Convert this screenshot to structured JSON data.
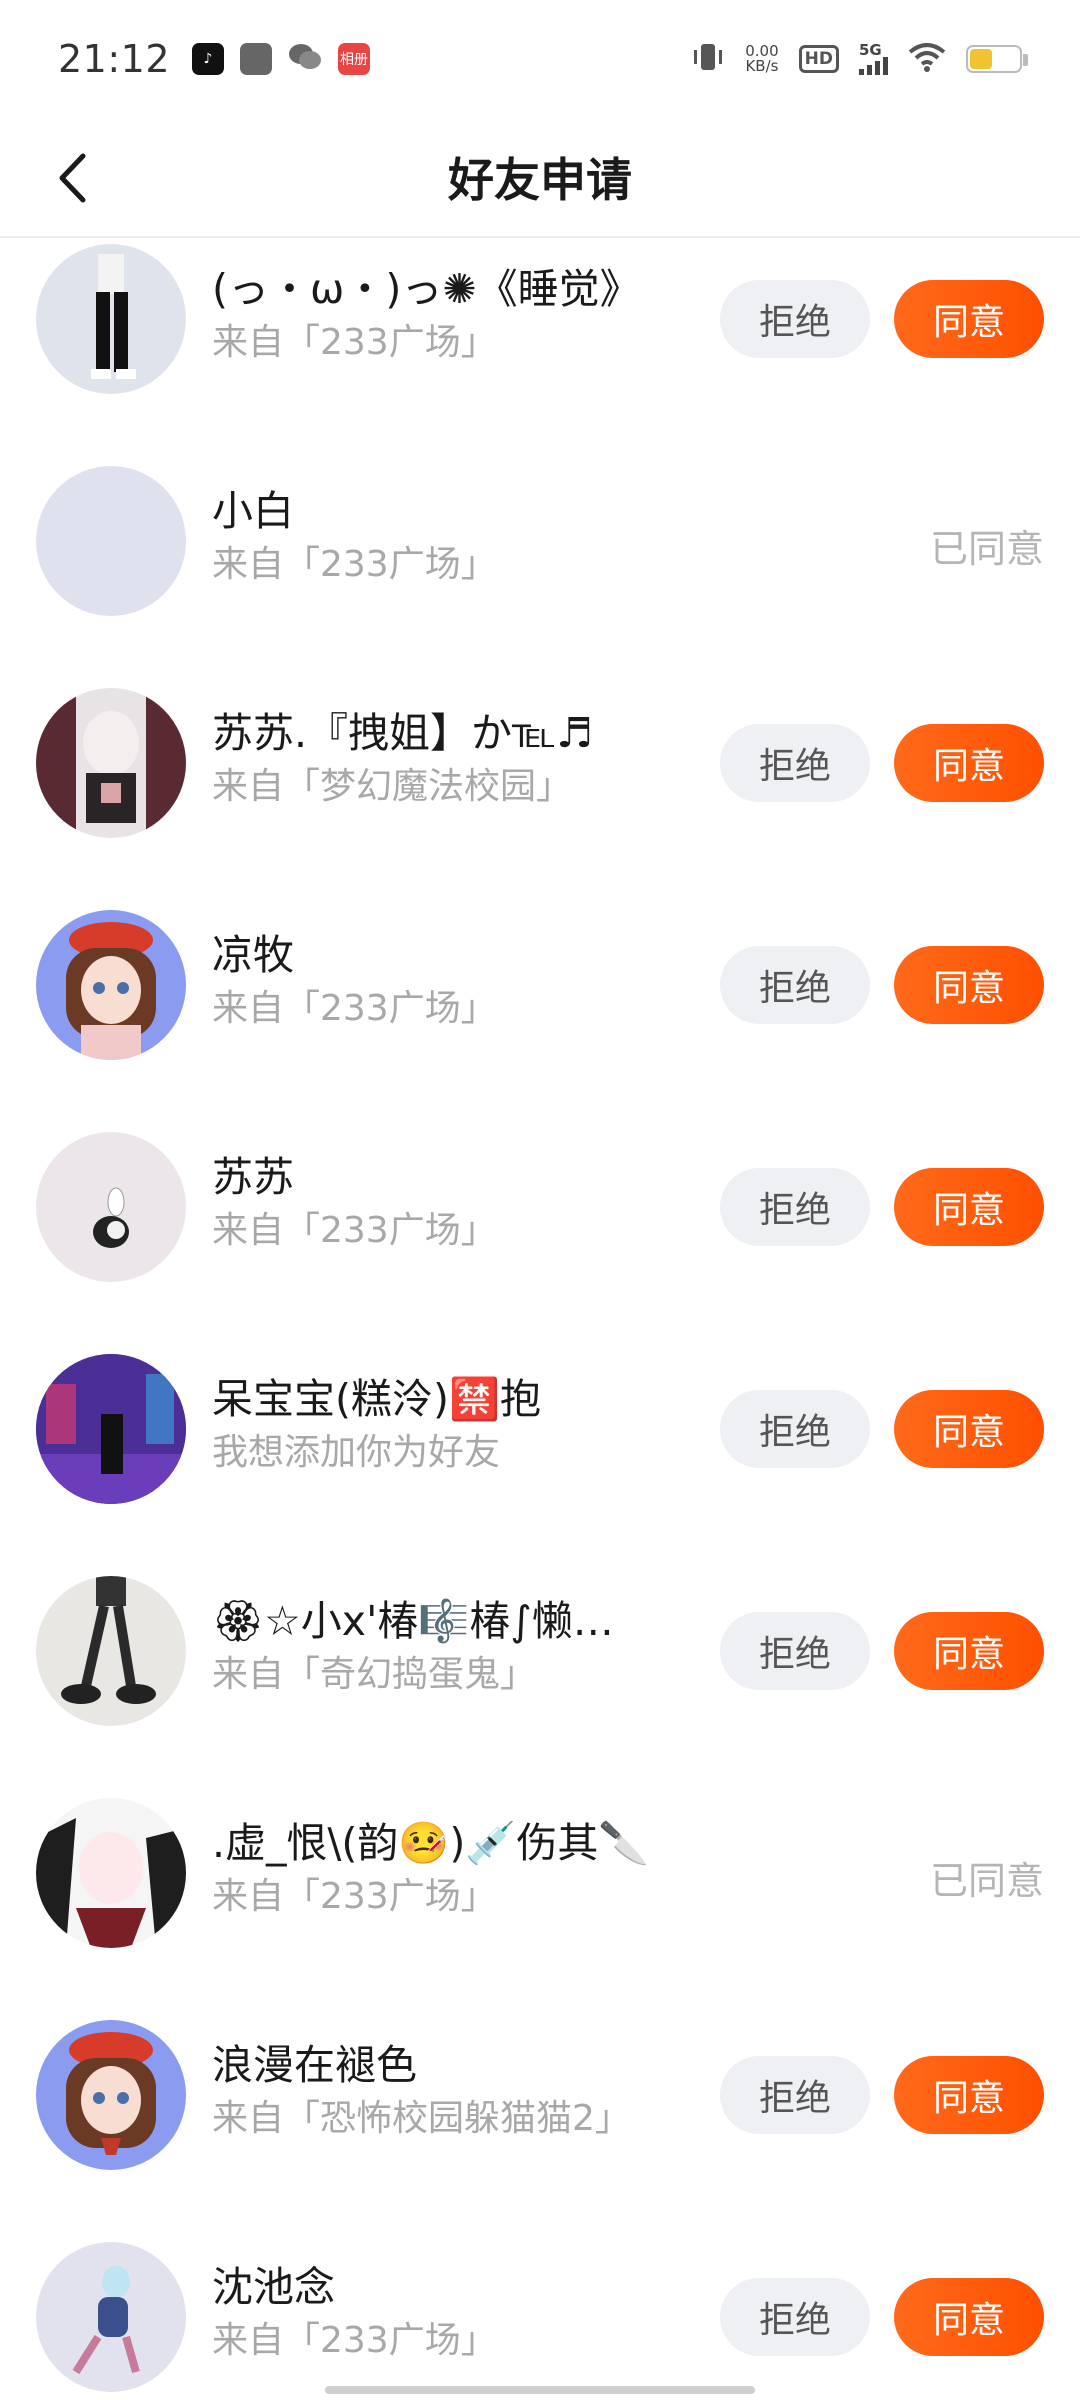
{
  "status_bar": {
    "time": "21:12",
    "net_speed_value": "0.00",
    "net_speed_unit": "KB/s",
    "hd": "HD",
    "network": "5G",
    "app_badge": "相册"
  },
  "header": {
    "title": "好友申请"
  },
  "buttons": {
    "reject": "拒绝",
    "accept": "同意",
    "accepted": "已同意"
  },
  "requests": [
    {
      "name": "(っ・ω・)っ✺《睡觉》",
      "source": "来自「233广场」",
      "status": "pending"
    },
    {
      "name": "小白",
      "source": "来自「233广场」",
      "status": "accepted"
    },
    {
      "name": "苏苏.『拽姐】か℡♬",
      "source": "来自「梦幻魔法校园」",
      "status": "pending"
    },
    {
      "name": "凉牧",
      "source": "来自「233广场」",
      "status": "pending"
    },
    {
      "name": "苏苏",
      "source": "来自「233广场」",
      "status": "pending"
    },
    {
      "name": "呆宝宝(糕泠)🈲抱",
      "source": "我想添加你为好友",
      "status": "pending"
    },
    {
      "name": "🏵☆小x'椿🎼椿∫懒…",
      "source": "来自「奇幻捣蛋鬼」",
      "status": "pending"
    },
    {
      "name": ".虚_恨\\(韵🤒)💉伤其🔪",
      "source": "来自「233广场」",
      "status": "accepted"
    },
    {
      "name": "浪漫在褪色",
      "source": "来自「恐怖校园躲猫猫2」",
      "status": "pending"
    },
    {
      "name": "沈池念",
      "source": "来自「233广场」",
      "status": "pending"
    }
  ],
  "colors": {
    "accent": "#ff5a0a",
    "reject_bg": "#eef0f4",
    "muted_text": "#a8a8a8"
  }
}
